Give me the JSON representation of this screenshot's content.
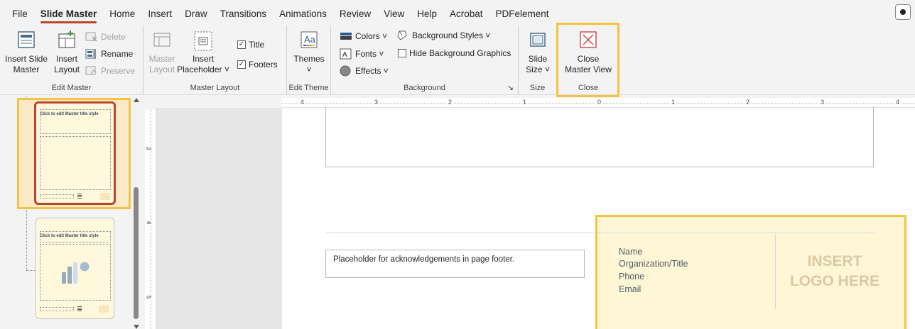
{
  "menubar": {
    "items": [
      "File",
      "Slide Master",
      "Home",
      "Insert",
      "Draw",
      "Transitions",
      "Animations",
      "Review",
      "View",
      "Help",
      "Acrobat",
      "PDFelement"
    ],
    "active": "Slide Master"
  },
  "ribbon": {
    "edit_master": {
      "label": "Edit Master",
      "insert_slide_master": [
        "Insert Slide",
        "Master"
      ],
      "insert_layout": [
        "Insert",
        "Layout"
      ],
      "delete": "Delete",
      "rename": "Rename",
      "preserve": "Preserve"
    },
    "master_layout": {
      "label": "Master Layout",
      "master_layout_btn": [
        "Master",
        "Layout"
      ],
      "insert_placeholder": [
        "Insert",
        "Placeholder ˅"
      ],
      "title": "Title",
      "footers": "Footers"
    },
    "edit_theme": {
      "label": "Edit Theme",
      "themes": "Themes",
      "themes_caret": "˅"
    },
    "background": {
      "label": "Background",
      "colors": "Colors ˅",
      "fonts": "Fonts ˅",
      "effects": "Effects ˅",
      "background_styles": "Background Styles ˅",
      "hide_background_graphics": "Hide Background Graphics",
      "launcher": "↘"
    },
    "size": {
      "label": "Size",
      "slide_size": [
        "Slide",
        "Size ˅"
      ]
    },
    "close": {
      "label": "Close",
      "close_master_view": [
        "Close",
        "Master View"
      ]
    }
  },
  "thumbnails": [
    {
      "title": "Click to edit Master title style",
      "selected": true
    },
    {
      "title": "Click to edit Master title style",
      "selected": false
    }
  ],
  "rulers": {
    "horizontal": [
      "4",
      "3",
      "2",
      "1",
      "0",
      "1",
      "2",
      "3",
      "4"
    ],
    "vertical": [
      "3",
      "4",
      "5"
    ]
  },
  "slide": {
    "footer_placeholder": "Placeholder for acknowledgements in page footer.",
    "contact": [
      "Name",
      "Organization/Title",
      "Phone",
      "Email"
    ],
    "logo": [
      "INSERT",
      "LOGO HERE"
    ]
  },
  "colors": {
    "accent": "#b7472a",
    "highlight": "#f5c242",
    "footer_bg": "#fff6d5"
  }
}
